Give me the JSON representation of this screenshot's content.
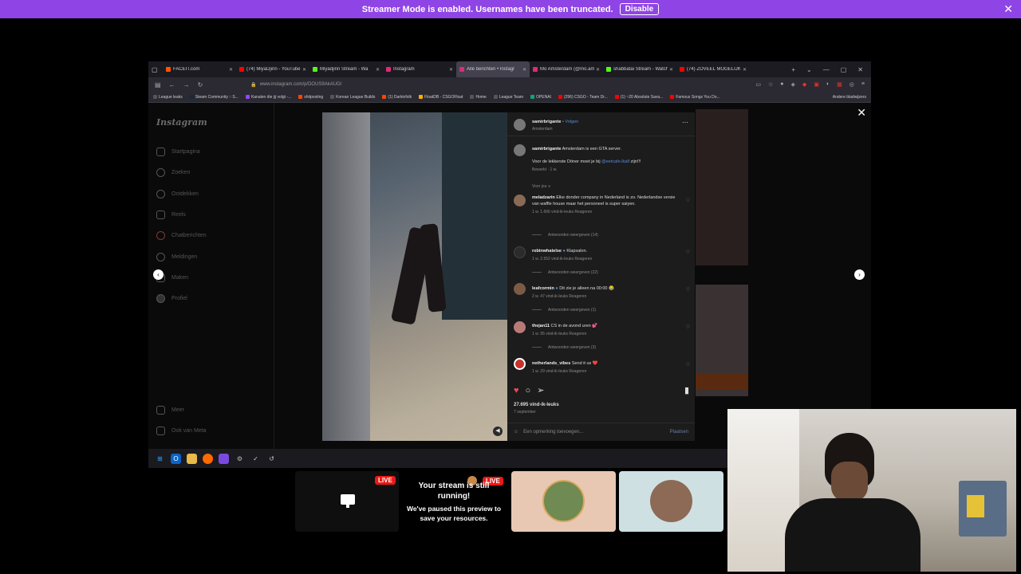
{
  "banner": {
    "text": "Streamer Mode is enabled. Usernames have been truncated.",
    "button": "Disable"
  },
  "tabs": [
    {
      "label": "FACEIT.com",
      "color": "#ff5500"
    },
    {
      "label": "(74) MiyaDjinn - YouTube",
      "color": "#ff0000"
    },
    {
      "label": "Miyadjinn Stream - Wa",
      "color": "#53fc18"
    },
    {
      "label": "Instagram",
      "color": "#dd2a7b"
    },
    {
      "label": "Alle berichten • Instagr",
      "color": "#dd2a7b",
      "active": true
    },
    {
      "label": "Mo Amsterdam (@mo.am",
      "color": "#dd2a7b"
    },
    {
      "label": "shabbatai Stream - Watch",
      "color": "#53fc18"
    },
    {
      "label": "(74) ZOVEEL MOGELIJK KI",
      "color": "#ff0000"
    }
  ],
  "address": {
    "url": "www.instagram.com/p/DOUS9AkAUG/"
  },
  "bookmarks": [
    {
      "label": "League leaks",
      "color": "#555"
    },
    {
      "label": "Steam Community :: S...",
      "color": "#1b2838"
    },
    {
      "label": "Kanalen die jij volgt -...",
      "color": "#9146ff"
    },
    {
      "label": "shitposting",
      "color": "#ff4500"
    },
    {
      "label": "Korean League Builds",
      "color": "#555"
    },
    {
      "label": "(1) Darkinfolk",
      "color": "#ff4500"
    },
    {
      "label": "FloatDB - CSGOFloat",
      "color": "#ffb000"
    },
    {
      "label": "Home",
      "color": "#555"
    },
    {
      "label": "League Team",
      "color": "#555"
    },
    {
      "label": "OPENAI",
      "color": "#10a37f"
    },
    {
      "label": "(296) CSGO - Team Dr...",
      "color": "#ff0000"
    },
    {
      "label": "(1) ~20 Absolute Sava...",
      "color": "#ff0000"
    },
    {
      "label": "Famous Songs You Do...",
      "color": "#ff0000"
    }
  ],
  "bookmarks_other": "Andere bladwijzers",
  "sidebar": {
    "logo": "Instagram",
    "items": [
      "Startpagina",
      "Zoeken",
      "Ontdekken",
      "Reels",
      "Chatberichten",
      "Meldingen",
      "Maken",
      "Profiel"
    ],
    "more": "Meer",
    "meta": "Ook van Meta"
  },
  "post": {
    "author": "samirbrigante",
    "follow": "Volgen",
    "location": "Amsterdam",
    "caption_user": "samirbrigante",
    "caption": "Amsterdam is een GTA server.",
    "caption2_pre": "Voor de lekkerste Döner moet je bij",
    "caption2_tag": "@eetcafe.lkalf",
    "caption2_post": "zijn!!!",
    "caption_meta": "Bewerkt · 1 w.",
    "sort": "Voor jou ∨",
    "comments": [
      {
        "user": "meladzarin",
        "text": "Elke donder company in Nederland is zo. Nederlandse versie van waffle house maar het personeel is super saiyen.",
        "meta": "1 w.   1.666 vind-ik-leuks   Reageren",
        "replies": "Antwoorden weergeven (14)",
        "avatar": "#8a6a55"
      },
      {
        "user": "robinwhatelse",
        "text": "Klapsalon.",
        "meta": "1 w.   2.552 vind-ik-leuks   Reageren",
        "replies": "Antwoorden weergeven (22)",
        "avatar": "#2b2b2b"
      },
      {
        "user": "leafcormin",
        "text": "Dit zie je alleen na 00:00 😂",
        "meta": "2 w.   47 vind-ik-leuks   Reageren",
        "replies": "Antwoorden weergeven (1)",
        "avatar": "#7b5a46"
      },
      {
        "user": "thejan11",
        "text": "CS in de avond uren 💕",
        "meta": "1 w.   95 vind-ik-leuks   Reageren",
        "replies": "Antwoorden weergeven (3)",
        "avatar": "#b87a78"
      },
      {
        "user": "netherlands_vibes",
        "text": "Send it us ❤️",
        "meta": "1 w.   29 vind-ik-leuks   Reageren",
        "replies": "",
        "avatar": "#c9312c"
      }
    ],
    "likes": "27.695 vind-ik-leuks",
    "date": "7 september",
    "add_comment": "Een opmerking toevoegen...",
    "post_button": "Plaatsen"
  },
  "stream": {
    "live": "LIVE",
    "paused_title": "Your stream is still running!",
    "paused_body": "We've paused this preview to save your resources."
  },
  "colors": {
    "banner": "#8f45e5",
    "live": "#e91916",
    "like": "#ed4956",
    "link": "#5b8cd6"
  }
}
